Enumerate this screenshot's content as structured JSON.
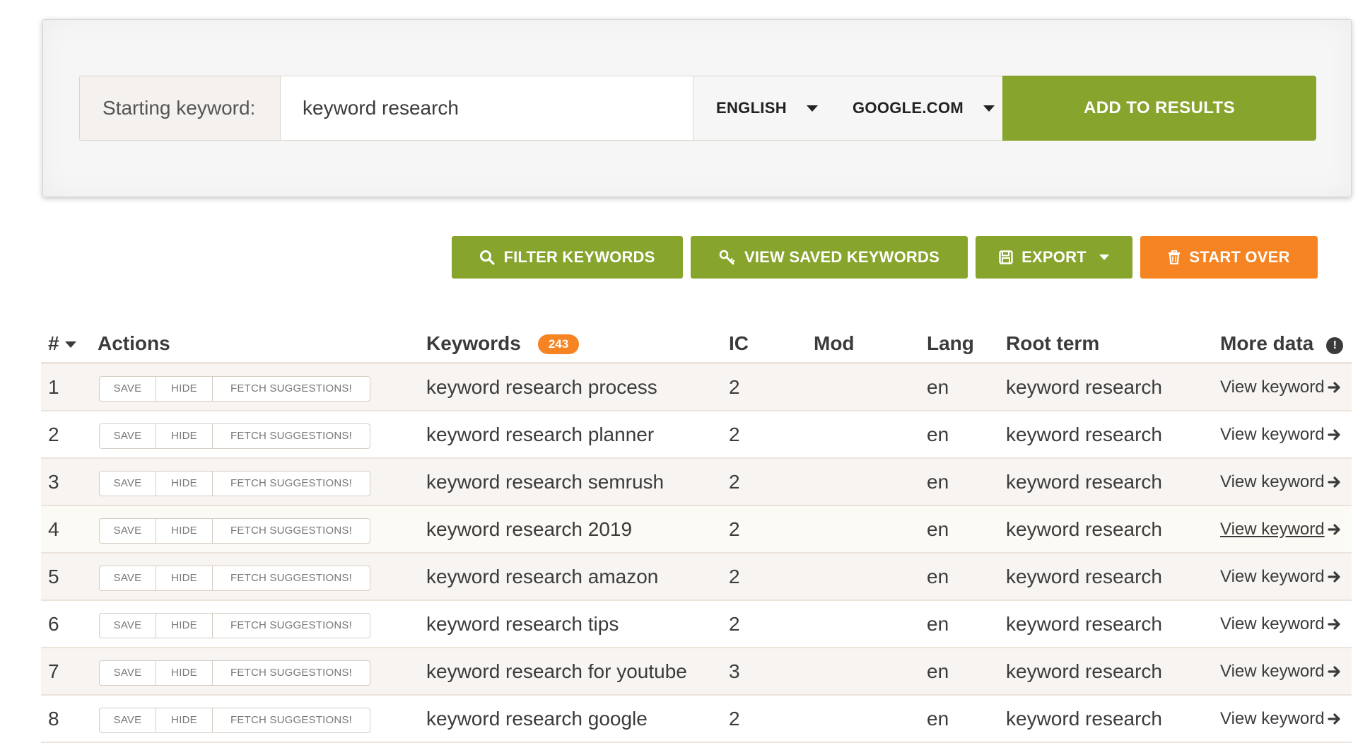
{
  "search": {
    "label": "Starting keyword:",
    "value": "keyword research",
    "language": "ENGLISH",
    "engine": "GOOGLE.COM",
    "add_label": "ADD TO RESULTS"
  },
  "toolbar": {
    "filter_label": "FILTER KEYWORDS",
    "saved_label": "VIEW SAVED KEYWORDS",
    "export_label": "EXPORT",
    "start_over_label": "START OVER"
  },
  "colors": {
    "accent_green": "#87a42c",
    "accent_orange": "#f68422"
  },
  "table": {
    "headers": {
      "num": "#",
      "actions": "Actions",
      "keywords": "Keywords",
      "keyword_count": "243",
      "ic": "IC",
      "mod": "Mod",
      "lang": "Lang",
      "root": "Root term",
      "more": "More data"
    },
    "action_labels": {
      "save": "SAVE",
      "hide": "HIDE",
      "fetch": "FETCH SUGGESTIONS!"
    },
    "rows": [
      {
        "num": "1",
        "keyword": "keyword research process",
        "ic": "2",
        "mod": "",
        "lang": "en",
        "root": "keyword research",
        "more": "View keyword"
      },
      {
        "num": "2",
        "keyword": "keyword research planner",
        "ic": "2",
        "mod": "",
        "lang": "en",
        "root": "keyword research",
        "more": "View keyword"
      },
      {
        "num": "3",
        "keyword": "keyword research semrush",
        "ic": "2",
        "mod": "",
        "lang": "en",
        "root": "keyword research",
        "more": "View keyword"
      },
      {
        "num": "4",
        "keyword": "keyword research 2019",
        "ic": "2",
        "mod": "",
        "lang": "en",
        "root": "keyword research",
        "more": "View keyword"
      },
      {
        "num": "5",
        "keyword": "keyword research amazon",
        "ic": "2",
        "mod": "",
        "lang": "en",
        "root": "keyword research",
        "more": "View keyword"
      },
      {
        "num": "6",
        "keyword": "keyword research tips",
        "ic": "2",
        "mod": "",
        "lang": "en",
        "root": "keyword research",
        "more": "View keyword"
      },
      {
        "num": "7",
        "keyword": "keyword research for youtube",
        "ic": "3",
        "mod": "",
        "lang": "en",
        "root": "keyword research",
        "more": "View keyword"
      },
      {
        "num": "8",
        "keyword": "keyword research google",
        "ic": "2",
        "mod": "",
        "lang": "en",
        "root": "keyword research",
        "more": "View keyword"
      }
    ]
  }
}
